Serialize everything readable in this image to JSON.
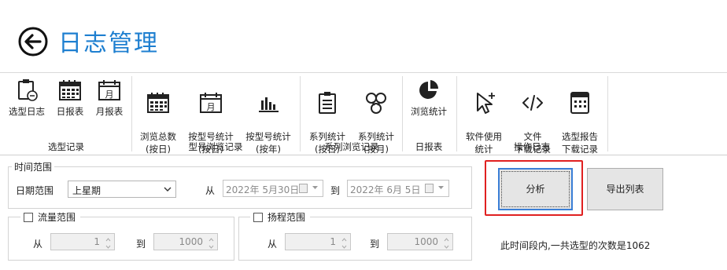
{
  "header": {
    "title": "日志管理",
    "back_icon": "back-arrow-icon",
    "title_color": "#1e7fd0"
  },
  "ribbon": {
    "groups": [
      {
        "label": "选型记录",
        "items": [
          {
            "label": "选型日志",
            "icon": "clipboard-icon"
          },
          {
            "label": "日报表",
            "icon": "calendar-icon"
          },
          {
            "label": "月报表",
            "icon": "calendar-month-icon"
          }
        ]
      },
      {
        "label": "型号浏览记录",
        "items": [
          {
            "label": "浏览总数\n(按日)",
            "icon": "calendar-icon"
          },
          {
            "label": "按型号统计\n(按日)",
            "icon": "calendar-month-icon"
          },
          {
            "label": "按型号统计\n(按年)",
            "icon": "bar-chart-icon"
          }
        ]
      },
      {
        "label": "系列浏览记录",
        "items": [
          {
            "label": "系列统计\n(按日)",
            "icon": "clipboard-list-icon"
          },
          {
            "label": "系列统计\n(按月)",
            "icon": "network-icon"
          }
        ]
      },
      {
        "label": "日报表",
        "items": [
          {
            "label": "浏览统计",
            "icon": "pie-chart-icon"
          }
        ]
      },
      {
        "label": "操作日志",
        "items": [
          {
            "label": "软件使用\n统计",
            "icon": "cursor-click-icon"
          },
          {
            "label": "文件\n下载记录",
            "icon": "code-icon"
          },
          {
            "label": "选型报告\n下载记录",
            "icon": "calculator-icon"
          }
        ]
      }
    ]
  },
  "time_range": {
    "title": "时间范围",
    "date_range_label": "日期范围",
    "date_range_value": "上星期",
    "from_label": "从",
    "from_date": "2022年  5月30日",
    "to_label": "到",
    "to_date": "2022年  6月  5日"
  },
  "flow_range": {
    "title": "流量范围",
    "checked": false,
    "from_label": "从",
    "from_value": "1",
    "to_label": "到",
    "to_value": "1000"
  },
  "head_range": {
    "title": "扬程范围",
    "checked": false,
    "from_label": "从",
    "from_value": "1",
    "to_label": "到",
    "to_value": "1000"
  },
  "actions": {
    "analyze_label": "分析",
    "export_label": "导出列表",
    "highlight_color": "#e02020"
  },
  "summary": {
    "text": "此时间段内,一共选型的次数是1062"
  }
}
